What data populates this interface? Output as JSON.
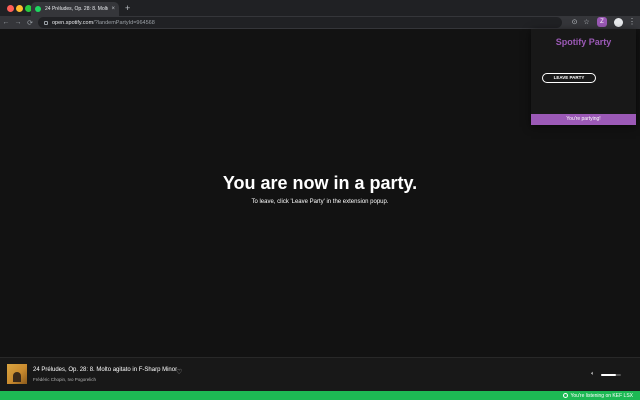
{
  "browser": {
    "tab_title": "24 Préludes, Op. 28: 8. Molto",
    "tab_close": "×",
    "new_tab": "+",
    "url_host": "open.spotify.com",
    "url_path": "/?landemPartyId=964568",
    "ext_icon_letter": "Z",
    "nav": {
      "back": "←",
      "forward": "→",
      "reload": "⟳"
    }
  },
  "main": {
    "headline": "You are now in a party.",
    "subline": "To leave, click 'Leave Party' in the extension popup."
  },
  "popup": {
    "title": "Spotify Party",
    "leave_button": "LEAVE PARTY",
    "status": "You're partying!"
  },
  "player": {
    "track": "24 Préludes, Op. 28: 8. Molto agitato in F-Sharp Minor",
    "artist": "Frédéric Chopin, Ivo Pogorelich",
    "volume": 0.75
  },
  "banner": {
    "text": "You're listening on KEF LSX"
  },
  "colors": {
    "accent": "#9b59b6",
    "spotify_green": "#1db954",
    "background": "#121212"
  }
}
